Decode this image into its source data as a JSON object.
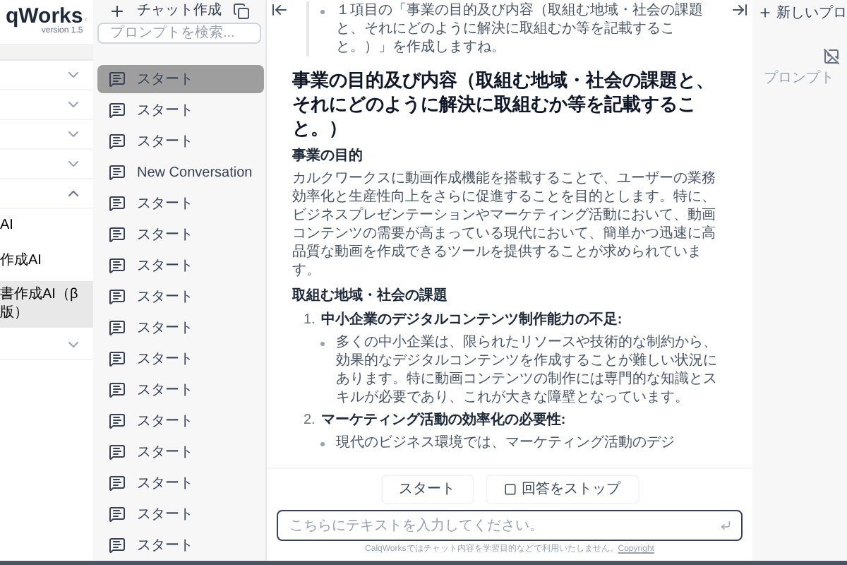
{
  "sidebar": {
    "logo": "qWorks",
    "version": "version 1.5",
    "sections": [
      {
        "expanded": false
      },
      {
        "expanded": false
      },
      {
        "expanded": false
      },
      {
        "expanded": false
      },
      {
        "expanded": true,
        "items": [
          {
            "label": "AI",
            "selected": false
          },
          {
            "label": "作成AI",
            "selected": false
          },
          {
            "label": "書作成AI（β版）",
            "selected": true
          }
        ]
      },
      {
        "expanded": false
      }
    ]
  },
  "chat_list": {
    "new_chat": "チャット作成",
    "search": {
      "placeholder": "プロンプトを検索..."
    },
    "items": [
      {
        "label": "スタート",
        "selected": true
      },
      {
        "label": "スタート",
        "selected": false
      },
      {
        "label": "スタート",
        "selected": false
      },
      {
        "label": "New Conversation",
        "selected": false
      },
      {
        "label": "スタート",
        "selected": false
      },
      {
        "label": "スタート",
        "selected": false
      },
      {
        "label": "スタート",
        "selected": false
      },
      {
        "label": "スタート",
        "selected": false
      },
      {
        "label": "スタート",
        "selected": false
      },
      {
        "label": "スタート",
        "selected": false
      },
      {
        "label": "スタート",
        "selected": false
      },
      {
        "label": "スタート",
        "selected": false
      },
      {
        "label": "スタート",
        "selected": false
      },
      {
        "label": "スタート",
        "selected": false
      },
      {
        "label": "スタート",
        "selected": false
      },
      {
        "label": "スタート",
        "selected": false
      }
    ]
  },
  "message": {
    "quote": "１項目の「事業の目的及び内容（取組む地域・社会の課題と、それにどのように解決に取組むか等を記載すること。）」を作成しますね。",
    "heading": "事業の目的及び内容（取組む地域・社会の課題と、それにどのように解決に取組むか等を記載すること。）",
    "sections": [
      {
        "title": "事業の目的",
        "paragraph": "カルクワークスに動画作成機能を搭載することで、ユーザーの業務効率化と生産性向上をさらに促進することを目的とします。特に、ビジネスプレゼンテーションやマーケティング活動において、動画コンテンツの需要が高まっている現代において、簡単かつ迅速に高品質な動画を作成できるツールを提供することが求められています。"
      },
      {
        "title": "取組む地域・社会の課題",
        "list": [
          {
            "number": "1.",
            "title": "中小企業のデジタルコンテンツ制作能力の不足:",
            "bullets": [
              "多くの中小企業は、限られたリソースや技術的な制約から、効果的なデジタルコンテンツを作成することが難しい状況にあります。特に動画コンテンツの制作には専門的な知識とスキルが必要であり、これが大きな障壁となっています。"
            ]
          },
          {
            "number": "2.",
            "title": "マーケティング活動の効率化の必要性:",
            "bullets": [
              "現代のビジネス環境では、マーケティング活動のデジ"
            ]
          }
        ]
      }
    ]
  },
  "composer": {
    "start_button": "スタート",
    "stop_button": "回答をストップ",
    "input": {
      "placeholder": "こちらにテキストを入力してください。"
    },
    "notice": "CalqWorksではチャット内容を学習目的などで利用いたしません。",
    "link": "Copyright"
  },
  "prompt_panel": {
    "new_prompt": "新しいプロ",
    "empty_text": "プロンプト"
  }
}
